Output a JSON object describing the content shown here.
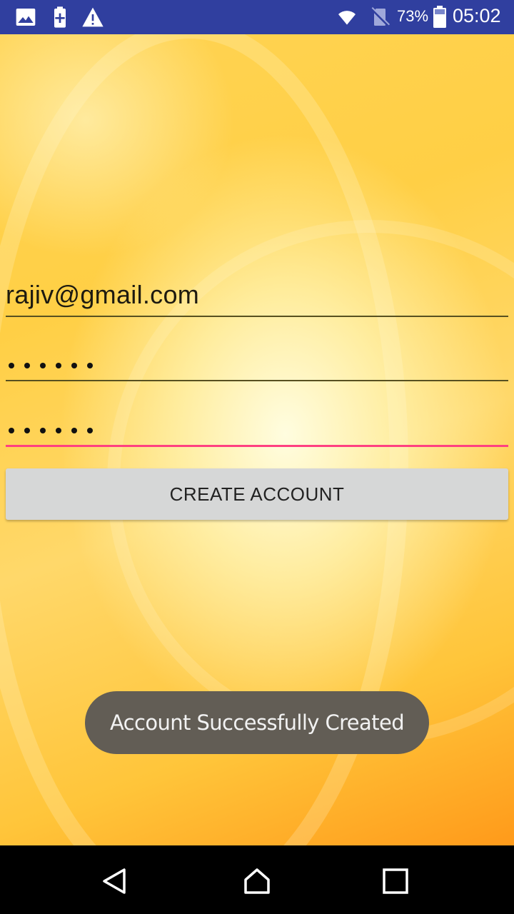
{
  "status_bar": {
    "icons_left": [
      "image-icon",
      "battery-plus-icon",
      "warning-icon"
    ],
    "wifi_icon": "wifi-icon",
    "sim_icon": "no-sim-icon",
    "battery_percent": "73%",
    "battery_icon": "battery-icon",
    "time": "05:02",
    "background_color": "#303f9f"
  },
  "form": {
    "email_value": "rajiv@gmail.com",
    "password_mask_length": 6,
    "confirm_password_mask_length": 6,
    "create_account_label": "CREATE ACCOUNT",
    "focus_color": "#ff4081"
  },
  "toast": {
    "message": "Account Successfully Created"
  },
  "nav_bar": {
    "back_icon": "back-triangle-icon",
    "home_icon": "home-icon",
    "recent_icon": "recent-apps-icon"
  }
}
